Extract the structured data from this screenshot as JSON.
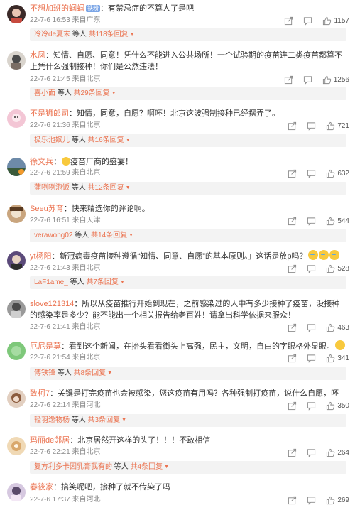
{
  "comments": [
    {
      "user": "不想加班的蝈蝈",
      "badge": "铁粉",
      "text": "有禁忌症的不算人了是吧",
      "time": "22-7-6 16:53 来自广东",
      "likes": "1157",
      "reply": {
        "user": "冷冷de夏末",
        "mid": "等人",
        "total": "共118条回复"
      }
    },
    {
      "user": "水凤",
      "text": "知情、自愿、同意！凭什么不能进入公共场所！一个试验期的疫苗连二类疫苗都算不上凭什么强制接种！你们是公然违法！",
      "time": "22-7-6 21:45 来自北京",
      "likes": "1256",
      "reply": {
        "user": "喜小面",
        "mid": "等人",
        "total": "共29条回复"
      }
    },
    {
      "user": "不是狮郎司",
      "text": "知情，同意，自愿？啊呸！北京这波强制接种已经摆弄了。",
      "time": "22-7-6 21:36 来自北京",
      "likes": "721",
      "reply": {
        "user": "极乐池嫔儿",
        "mid": "等人",
        "total": "共16条回复"
      }
    },
    {
      "user": "徐文兵",
      "text": "疫苗厂商的盛宴！",
      "time": "22-7-6 21:59 来自北京",
      "likes": "632",
      "reply": {
        "user": "蒲咧咧泡饭",
        "mid": "等人",
        "total": "共12条回复"
      }
    },
    {
      "user": "Seeu苏育",
      "text": "快来精选你的评论啊。",
      "time": "22-7-6 16:51 来自天津",
      "likes": "544",
      "reply": {
        "user": "verawong02",
        "mid": "等人",
        "total": "共14条回复"
      }
    },
    {
      "user": "yt杨阳",
      "text": "新冠病毒疫苗接种遵循“知情、同意、自愿”的基本原则。」这话是放p吗？",
      "time": "22-7-6 21:43 来自北京",
      "likes": "528",
      "reply": {
        "user": "LaF1ame_",
        "mid": "等人",
        "total": "共7条回复"
      }
    },
    {
      "user": "slove121314",
      "text": "所以从疫苗推行开始到现在，之前感染过的人中有多少接种了疫苗，没接种的感染率是多少？能不能出一个相关报告给老百姓！请拿出科学依据来服众！",
      "time": "22-7-6 21:41 来自北京",
      "likes": "463",
      "reply": null
    },
    {
      "user": "厄尼是莫",
      "text": "看到这个新闻，在抬头看看街头上高强，民主，文明，自由的字眼格外显眼。",
      "time": "22-7-6 21:54 来自北京",
      "likes": "341",
      "reply": {
        "user": "傅铁锋",
        "mid": "等人",
        "total": "共8条回复"
      }
    },
    {
      "user": "致柯7",
      "text": "关键是打完疫苗也会被感染，您这疫苗有用吗？各种强制打疫苗，说什么自愿，呸",
      "time": "22-7-6 22:14 来自河北",
      "likes": "350",
      "reply": {
        "user": "轻羽逸物杨",
        "mid": "等人",
        "total": "共3条回复"
      }
    },
    {
      "user": "玛丽de邻居",
      "text": "北京居然开这样的头了！！！不敢相信",
      "time": "22-7-6 22:21 来自北京",
      "likes": "264",
      "reply": {
        "user": "复方利多卡因乳膏我有的",
        "mid": "等人",
        "total": "共4条回复"
      }
    },
    {
      "user": "春筱家",
      "text": "搞笑呢吧，接种了就不传染了吗",
      "time": "22-7-6 17:37 来自河北",
      "likes": "269",
      "reply": null
    }
  ],
  "colors": {
    "accent": "#eb7350",
    "meta": "#8a8a8a",
    "reply_bg": "#f3f3f3"
  },
  "icons": [
    "share-icon",
    "comment-icon",
    "like-icon"
  ]
}
